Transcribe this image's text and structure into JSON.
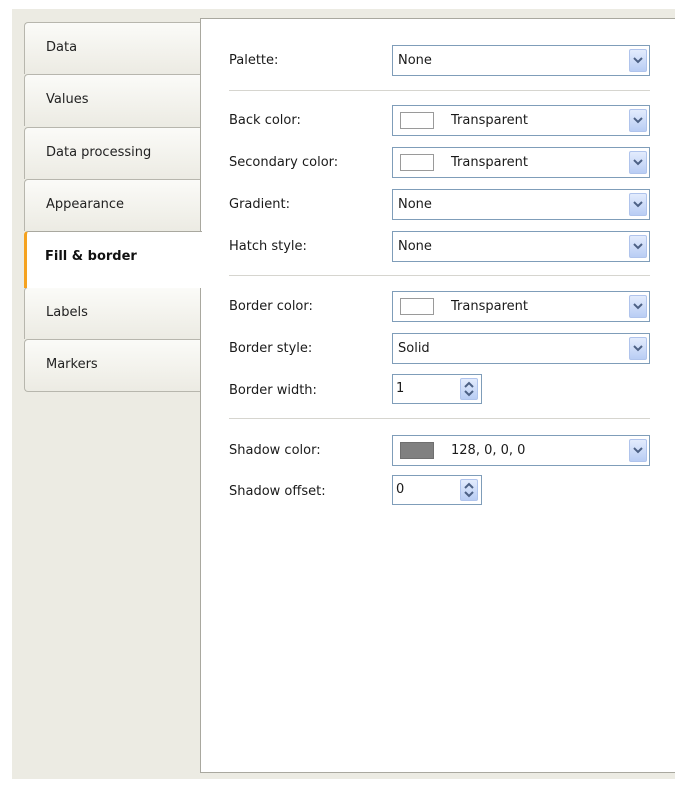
{
  "tabs": [
    {
      "label": "Data"
    },
    {
      "label": "Values"
    },
    {
      "label": "Data processing"
    },
    {
      "label": "Appearance"
    },
    {
      "label": "Fill & border"
    },
    {
      "label": "Labels"
    },
    {
      "label": "Markers"
    }
  ],
  "active_tab": "Fill & border",
  "fields": {
    "palette": {
      "label": "Palette:",
      "value": "None"
    },
    "back_color": {
      "label": "Back color:",
      "value": "Transparent",
      "swatch": "#ffffff"
    },
    "secondary_color": {
      "label": "Secondary color:",
      "value": "Transparent",
      "swatch": "#ffffff"
    },
    "gradient": {
      "label": "Gradient:",
      "value": "None"
    },
    "hatch_style": {
      "label": "Hatch style:",
      "value": "None"
    },
    "border_color": {
      "label": "Border color:",
      "value": "Transparent",
      "swatch": "#ffffff"
    },
    "border_style": {
      "label": "Border style:",
      "value": "Solid"
    },
    "border_width": {
      "label": "Border width:",
      "value": "1"
    },
    "shadow_color": {
      "label": "Shadow color:",
      "value": "128, 0, 0, 0",
      "swatch": "#808080"
    },
    "shadow_offset": {
      "label": "Shadow offset:",
      "value": "0"
    }
  },
  "colors": {
    "accent": "#f5a21f",
    "dropdown_arrow": "#4d6185"
  }
}
